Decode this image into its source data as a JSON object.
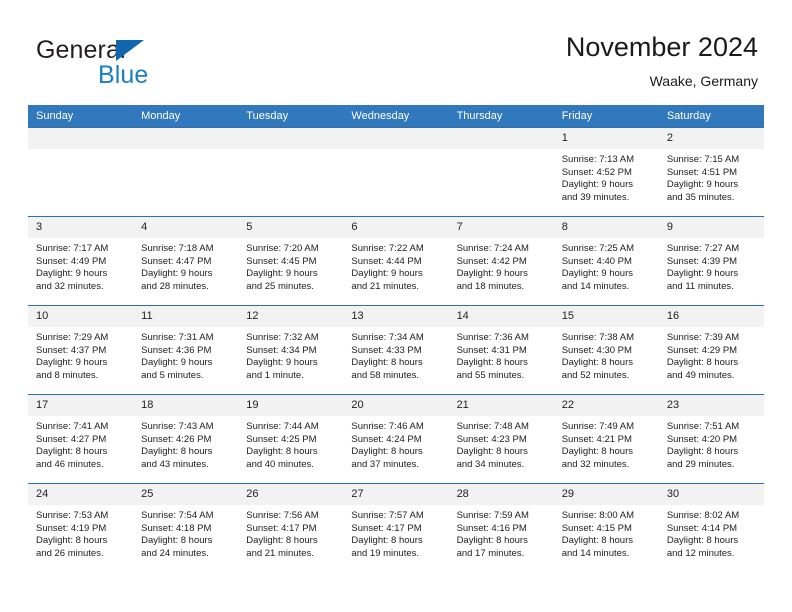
{
  "brand": {
    "name_part1": "General",
    "name_part2": "Blue",
    "flag_icon": "triangle-flag-icon",
    "accent_color": "#1b7fc4"
  },
  "header": {
    "title": "November 2024",
    "subtitle": "Waake, Germany"
  },
  "theme": {
    "header_bg": "#3179bc",
    "daynum_bg": "#f2f2f2",
    "grid_line": "#2f6fae"
  },
  "calendar": {
    "weekday_headers": [
      "Sunday",
      "Monday",
      "Tuesday",
      "Wednesday",
      "Thursday",
      "Friday",
      "Saturday"
    ],
    "weeks": [
      [
        {
          "day": "",
          "empty": true
        },
        {
          "day": "",
          "empty": true
        },
        {
          "day": "",
          "empty": true
        },
        {
          "day": "",
          "empty": true
        },
        {
          "day": "",
          "empty": true
        },
        {
          "day": "1",
          "sunrise": "Sunrise: 7:13 AM",
          "sunset": "Sunset: 4:52 PM",
          "daylight1": "Daylight: 9 hours",
          "daylight2": "and 39 minutes."
        },
        {
          "day": "2",
          "sunrise": "Sunrise: 7:15 AM",
          "sunset": "Sunset: 4:51 PM",
          "daylight1": "Daylight: 9 hours",
          "daylight2": "and 35 minutes."
        }
      ],
      [
        {
          "day": "3",
          "sunrise": "Sunrise: 7:17 AM",
          "sunset": "Sunset: 4:49 PM",
          "daylight1": "Daylight: 9 hours",
          "daylight2": "and 32 minutes."
        },
        {
          "day": "4",
          "sunrise": "Sunrise: 7:18 AM",
          "sunset": "Sunset: 4:47 PM",
          "daylight1": "Daylight: 9 hours",
          "daylight2": "and 28 minutes."
        },
        {
          "day": "5",
          "sunrise": "Sunrise: 7:20 AM",
          "sunset": "Sunset: 4:45 PM",
          "daylight1": "Daylight: 9 hours",
          "daylight2": "and 25 minutes."
        },
        {
          "day": "6",
          "sunrise": "Sunrise: 7:22 AM",
          "sunset": "Sunset: 4:44 PM",
          "daylight1": "Daylight: 9 hours",
          "daylight2": "and 21 minutes."
        },
        {
          "day": "7",
          "sunrise": "Sunrise: 7:24 AM",
          "sunset": "Sunset: 4:42 PM",
          "daylight1": "Daylight: 9 hours",
          "daylight2": "and 18 minutes."
        },
        {
          "day": "8",
          "sunrise": "Sunrise: 7:25 AM",
          "sunset": "Sunset: 4:40 PM",
          "daylight1": "Daylight: 9 hours",
          "daylight2": "and 14 minutes."
        },
        {
          "day": "9",
          "sunrise": "Sunrise: 7:27 AM",
          "sunset": "Sunset: 4:39 PM",
          "daylight1": "Daylight: 9 hours",
          "daylight2": "and 11 minutes."
        }
      ],
      [
        {
          "day": "10",
          "sunrise": "Sunrise: 7:29 AM",
          "sunset": "Sunset: 4:37 PM",
          "daylight1": "Daylight: 9 hours",
          "daylight2": "and 8 minutes."
        },
        {
          "day": "11",
          "sunrise": "Sunrise: 7:31 AM",
          "sunset": "Sunset: 4:36 PM",
          "daylight1": "Daylight: 9 hours",
          "daylight2": "and 5 minutes."
        },
        {
          "day": "12",
          "sunrise": "Sunrise: 7:32 AM",
          "sunset": "Sunset: 4:34 PM",
          "daylight1": "Daylight: 9 hours",
          "daylight2": "and 1 minute."
        },
        {
          "day": "13",
          "sunrise": "Sunrise: 7:34 AM",
          "sunset": "Sunset: 4:33 PM",
          "daylight1": "Daylight: 8 hours",
          "daylight2": "and 58 minutes."
        },
        {
          "day": "14",
          "sunrise": "Sunrise: 7:36 AM",
          "sunset": "Sunset: 4:31 PM",
          "daylight1": "Daylight: 8 hours",
          "daylight2": "and 55 minutes."
        },
        {
          "day": "15",
          "sunrise": "Sunrise: 7:38 AM",
          "sunset": "Sunset: 4:30 PM",
          "daylight1": "Daylight: 8 hours",
          "daylight2": "and 52 minutes."
        },
        {
          "day": "16",
          "sunrise": "Sunrise: 7:39 AM",
          "sunset": "Sunset: 4:29 PM",
          "daylight1": "Daylight: 8 hours",
          "daylight2": "and 49 minutes."
        }
      ],
      [
        {
          "day": "17",
          "sunrise": "Sunrise: 7:41 AM",
          "sunset": "Sunset: 4:27 PM",
          "daylight1": "Daylight: 8 hours",
          "daylight2": "and 46 minutes."
        },
        {
          "day": "18",
          "sunrise": "Sunrise: 7:43 AM",
          "sunset": "Sunset: 4:26 PM",
          "daylight1": "Daylight: 8 hours",
          "daylight2": "and 43 minutes."
        },
        {
          "day": "19",
          "sunrise": "Sunrise: 7:44 AM",
          "sunset": "Sunset: 4:25 PM",
          "daylight1": "Daylight: 8 hours",
          "daylight2": "and 40 minutes."
        },
        {
          "day": "20",
          "sunrise": "Sunrise: 7:46 AM",
          "sunset": "Sunset: 4:24 PM",
          "daylight1": "Daylight: 8 hours",
          "daylight2": "and 37 minutes."
        },
        {
          "day": "21",
          "sunrise": "Sunrise: 7:48 AM",
          "sunset": "Sunset: 4:23 PM",
          "daylight1": "Daylight: 8 hours",
          "daylight2": "and 34 minutes."
        },
        {
          "day": "22",
          "sunrise": "Sunrise: 7:49 AM",
          "sunset": "Sunset: 4:21 PM",
          "daylight1": "Daylight: 8 hours",
          "daylight2": "and 32 minutes."
        },
        {
          "day": "23",
          "sunrise": "Sunrise: 7:51 AM",
          "sunset": "Sunset: 4:20 PM",
          "daylight1": "Daylight: 8 hours",
          "daylight2": "and 29 minutes."
        }
      ],
      [
        {
          "day": "24",
          "sunrise": "Sunrise: 7:53 AM",
          "sunset": "Sunset: 4:19 PM",
          "daylight1": "Daylight: 8 hours",
          "daylight2": "and 26 minutes."
        },
        {
          "day": "25",
          "sunrise": "Sunrise: 7:54 AM",
          "sunset": "Sunset: 4:18 PM",
          "daylight1": "Daylight: 8 hours",
          "daylight2": "and 24 minutes."
        },
        {
          "day": "26",
          "sunrise": "Sunrise: 7:56 AM",
          "sunset": "Sunset: 4:17 PM",
          "daylight1": "Daylight: 8 hours",
          "daylight2": "and 21 minutes."
        },
        {
          "day": "27",
          "sunrise": "Sunrise: 7:57 AM",
          "sunset": "Sunset: 4:17 PM",
          "daylight1": "Daylight: 8 hours",
          "daylight2": "and 19 minutes."
        },
        {
          "day": "28",
          "sunrise": "Sunrise: 7:59 AM",
          "sunset": "Sunset: 4:16 PM",
          "daylight1": "Daylight: 8 hours",
          "daylight2": "and 17 minutes."
        },
        {
          "day": "29",
          "sunrise": "Sunrise: 8:00 AM",
          "sunset": "Sunset: 4:15 PM",
          "daylight1": "Daylight: 8 hours",
          "daylight2": "and 14 minutes."
        },
        {
          "day": "30",
          "sunrise": "Sunrise: 8:02 AM",
          "sunset": "Sunset: 4:14 PM",
          "daylight1": "Daylight: 8 hours",
          "daylight2": "and 12 minutes."
        }
      ]
    ]
  }
}
